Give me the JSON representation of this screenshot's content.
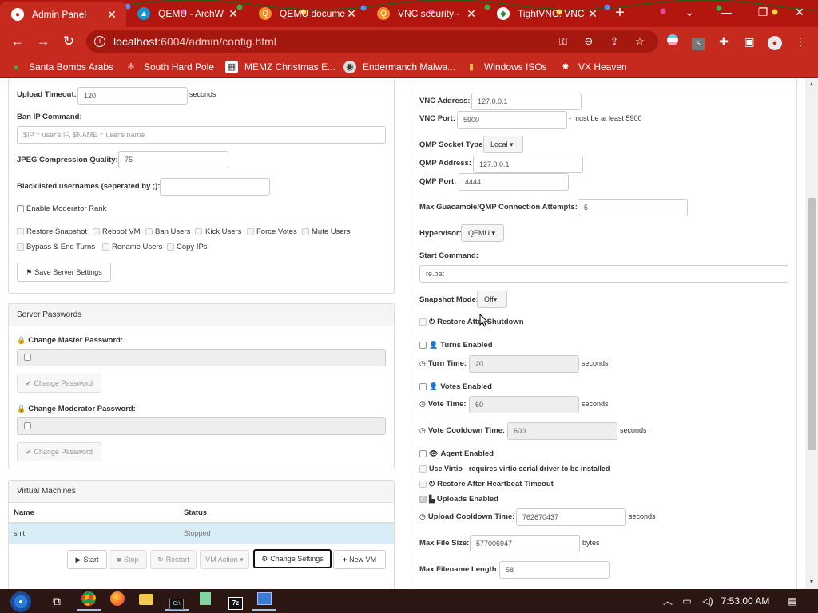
{
  "tabs": [
    {
      "title": "Admin Panel",
      "active": true,
      "close": "✕"
    },
    {
      "title": "QEMU - ArchW",
      "close": "✕"
    },
    {
      "title": "QEMU docume",
      "close": "✕"
    },
    {
      "title": "VNC security -",
      "close": "✕"
    },
    {
      "title": "TightVNC: VNC",
      "close": "✕"
    }
  ],
  "browser": {
    "url_host": "localhost",
    "url_path": ":6004/admin/config.html",
    "new_tab": "+"
  },
  "bookmarks": [
    {
      "label": "Santa Bombs Arabs",
      "icon": "christmas-tree-icon"
    },
    {
      "label": "South Hard Pole",
      "icon": "snowflake-icon"
    },
    {
      "label": "MEMZ Christmas E...",
      "icon": "memz-icon"
    },
    {
      "label": "Endermanch Malwa...",
      "icon": "raccoon-icon"
    },
    {
      "label": "Windows ISOs",
      "icon": "gift-icon"
    },
    {
      "label": "VX Heaven",
      "icon": "vx-icon"
    }
  ],
  "server_settings": {
    "upload_timeout_label": "Upload Timeout:",
    "upload_timeout_value": "120",
    "seconds": "seconds",
    "ban_ip_label": "Ban IP Command:",
    "ban_ip_placeholder": "$IP = user's IP, $NAME = user's name",
    "jpeg_label": "JPEG Compression Quality:",
    "jpeg_value": "75",
    "blacklist_label": "Blacklisted usernames (seperated by ;):",
    "blacklist_value": "",
    "enable_mod_label": "Enable Moderator Rank",
    "mod_perms": [
      "Restore Snapshot",
      "Reboot VM",
      "Ban Users",
      "Kick Users",
      "Force Votes",
      "Mute Users",
      "Bypass & End Turns",
      "Rename Users",
      "Copy IPs"
    ],
    "save_label": "Save Server Settings"
  },
  "passwords": {
    "heading": "Server Passwords",
    "master_label": "Change Master Password:",
    "change_btn": "Change Password",
    "mod_label": "Change Moderator Password:"
  },
  "vms": {
    "heading": "Virtual Machines",
    "col_name": "Name",
    "col_status": "Status",
    "rows": [
      {
        "name": "shit",
        "status": "Stopped"
      }
    ],
    "btn_start": "Start",
    "btn_stop": "Stop",
    "btn_restart": "Restart",
    "btn_action": "VM Action",
    "btn_change": "Change Settings",
    "btn_new": "New VM"
  },
  "vm_settings": {
    "vnc_address_label": "VNC Address:",
    "vnc_address": "127.0.0.1",
    "vnc_port_label": "VNC Port:",
    "vnc_port": "5900",
    "vnc_port_hint": "- must be at least 5900",
    "qmp_socket_label": "QMP Socket Type:",
    "qmp_socket_value": "Local",
    "qmp_address_label": "QMP Address:",
    "qmp_address": "127.0.0.1",
    "qmp_port_label": "QMP Port:",
    "qmp_port": "4444",
    "max_attempts_label": "Max Guacamole/QMP Connection Attempts:",
    "max_attempts": "5",
    "hypervisor_label": "Hypervisor:",
    "hypervisor_value": "QEMU",
    "start_cmd_label": "Start Command:",
    "start_cmd": "re.bat",
    "snapshot_label": "Snapshot Mode:",
    "snapshot_value": "Off",
    "restore_shutdown_label": "Restore After Shutdown",
    "turns_label": "Turns Enabled",
    "turn_time_label": "Turn Time:",
    "turn_time": "20",
    "votes_label": "Votes Enabled",
    "vote_time_label": "Vote Time:",
    "vote_time": "60",
    "vote_cooldown_label": "Vote Cooldown Time:",
    "vote_cooldown": "600",
    "agent_label": "Agent Enabled",
    "virtio_label": "Use Virtio - requires virtio serial driver to be installed",
    "heartbeat_label": "Restore After Heartbeat Timeout",
    "uploads_label": "Uploads Enabled",
    "upload_cooldown_label": "Upload Cooldown Time:",
    "upload_cooldown": "762670437",
    "max_file_label": "Max File Size:",
    "max_file": "577006947",
    "bytes": "bytes",
    "max_filename_label": "Max Filename Length:",
    "max_filename": "58"
  },
  "taskbar": {
    "time": "7:53:00 AM"
  }
}
